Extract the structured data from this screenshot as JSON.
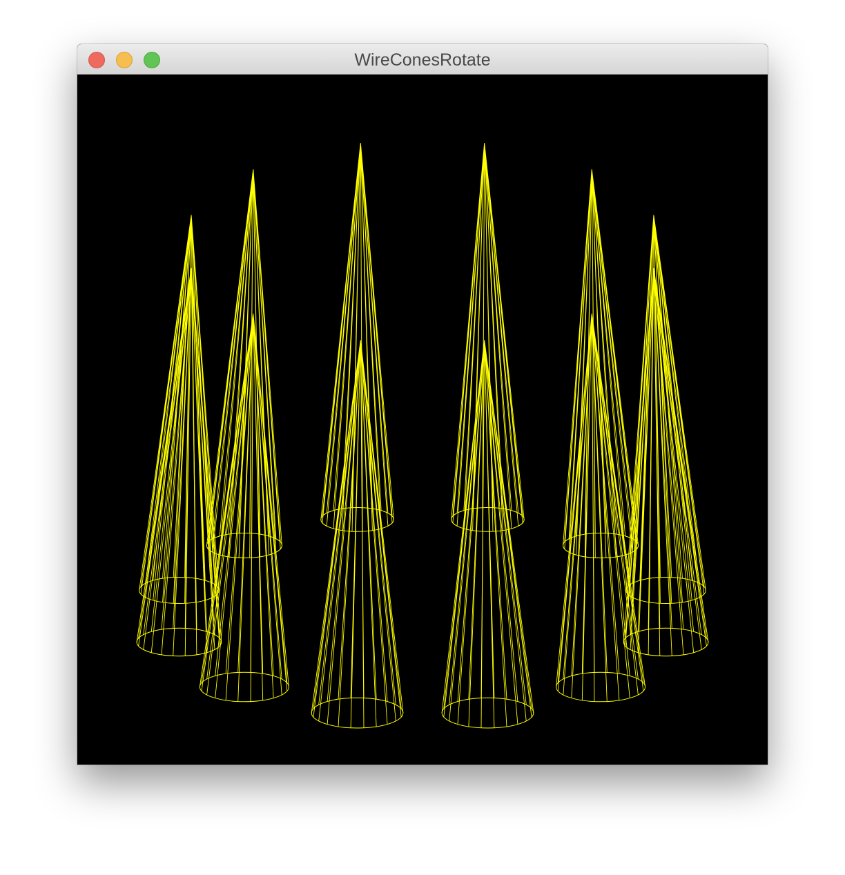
{
  "window": {
    "title": "WireConesRotate",
    "buttons": {
      "close": "close-button",
      "minimize": "minimize-button",
      "zoom": "zoom-button"
    }
  },
  "scene": {
    "background_color": "#000000",
    "wire_color": "#ffff00",
    "cone_count": 12,
    "arrangement": "ring",
    "render_style": "wireframe"
  }
}
